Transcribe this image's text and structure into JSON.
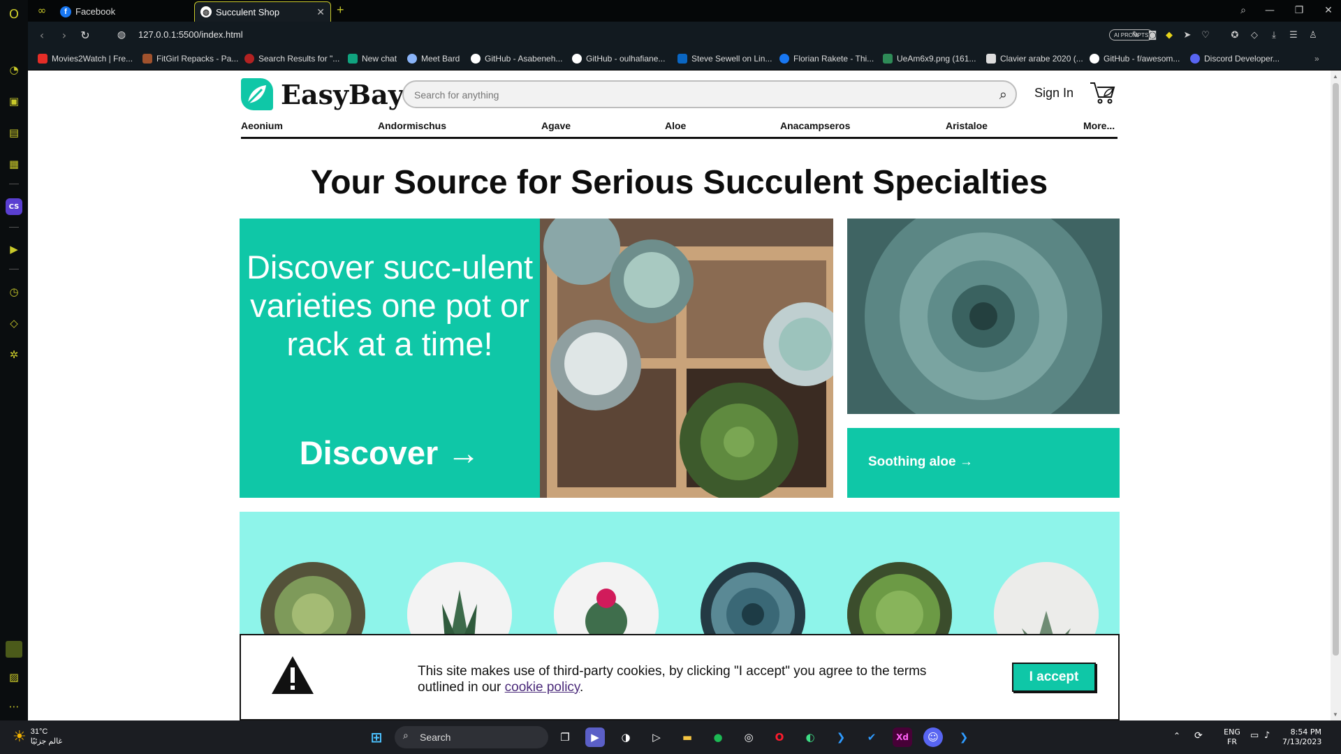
{
  "browser": {
    "tabs": [
      {
        "title": "Facebook",
        "favicon": "facebook-icon"
      },
      {
        "title": "Succulent Shop",
        "favicon": "globe-icon"
      }
    ],
    "new_tab": "+",
    "url": "127.0.0.1:5500/index.html",
    "ai_prompts": "AI PROMPTS",
    "bookmarks": [
      {
        "label": "Movies2Watch | Fre...",
        "icon": "youtube-icon",
        "color": "#e52d27"
      },
      {
        "label": "FitGirl Repacks - Pa...",
        "icon": "fitgirl-icon",
        "color": "#a0522d"
      },
      {
        "label": "Search Results for \"...",
        "icon": "skull-icon",
        "color": "#b22222"
      },
      {
        "label": "New chat",
        "icon": "chatgpt-icon",
        "color": "#10a37f"
      },
      {
        "label": "Meet Bard",
        "icon": "bard-sparkle-icon",
        "color": "#8ab4f8"
      },
      {
        "label": "GitHub - Asabeneh...",
        "icon": "github-icon",
        "color": "#ffffff"
      },
      {
        "label": "GitHub - oulhafiane...",
        "icon": "github-icon",
        "color": "#ffffff"
      },
      {
        "label": "Steve Sewell on Lin...",
        "icon": "linkedin-icon",
        "color": "#0a66c2"
      },
      {
        "label": "Florian Rakete - Thi...",
        "icon": "facebook-icon",
        "color": "#1877f2"
      },
      {
        "label": "UeAm6x9.png (161...",
        "icon": "image-icon",
        "color": "#2e8b57"
      },
      {
        "label": "Clavier arabe 2020 (...",
        "icon": "file-icon",
        "color": "#dddddd"
      },
      {
        "label": "GitHub - f/awesom...",
        "icon": "github-icon",
        "color": "#ffffff"
      },
      {
        "label": "Discord Developer...",
        "icon": "discord-icon",
        "color": "#5865f2"
      }
    ],
    "accent": "#c9c92a"
  },
  "site": {
    "brand": "EasyBay",
    "brand_color": "#0fc7a7",
    "search_placeholder": "Search for anything",
    "sign_in": "Sign In",
    "categories": [
      "Aeonium",
      "Andormischus",
      "Agave",
      "Aloe",
      "Anacampseros",
      "Aristaloe",
      "More..."
    ],
    "headline": "Your Source for Serious Succulent Specialties",
    "hero": {
      "text": "Discover succ-ulent varieties one pot or rack at a time!",
      "cta": "Discover →"
    },
    "side_promo": {
      "label": "Soothing aloe →"
    },
    "strip_color": "#8ef4ea"
  },
  "cookie": {
    "message_pre": "This site makes use of third-party cookies, by clicking \"I accept\" you agree to the terms outlined in our ",
    "link": "cookie policy",
    "message_post": ".",
    "accept": "I accept"
  },
  "taskbar": {
    "weather_temp": "31°C",
    "weather_text": "غالم جزئيًا",
    "search": "Search",
    "lang_top": "ENG",
    "lang_bottom": "FR",
    "time": "8:54 PM",
    "date": "7/13/2023"
  }
}
